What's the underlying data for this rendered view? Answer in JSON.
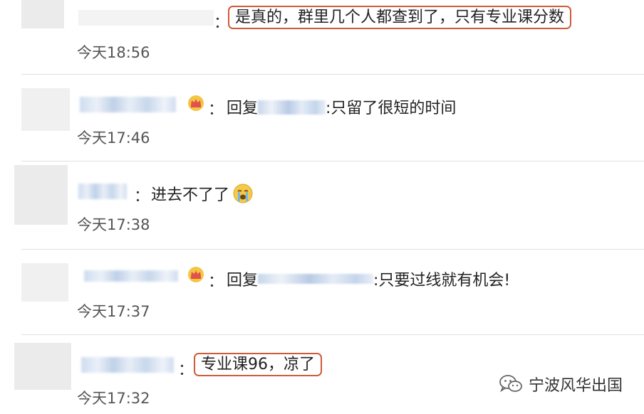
{
  "comments": [
    {
      "text": "是真的，群里几个人都查到了，只有专业课分数",
      "time": "今天18:56"
    },
    {
      "reply_prefix": "回复",
      "text": ":只留了很短的时间",
      "time": "今天17:46"
    },
    {
      "text": "进去不了了",
      "emoji": "crying-face-icon",
      "time": "今天17:38"
    },
    {
      "reply_prefix": "回复",
      "text": ":只要过线就有机会!",
      "time": "今天17:37"
    },
    {
      "text": "专业课96，凉了",
      "time": "今天17:32"
    }
  ],
  "colon": "：",
  "watermark": {
    "label": "宁波风华出国",
    "icon": "wechat-icon"
  },
  "colors": {
    "highlight_border": "#d05a3a",
    "blur_name": "#c9d9ee"
  }
}
